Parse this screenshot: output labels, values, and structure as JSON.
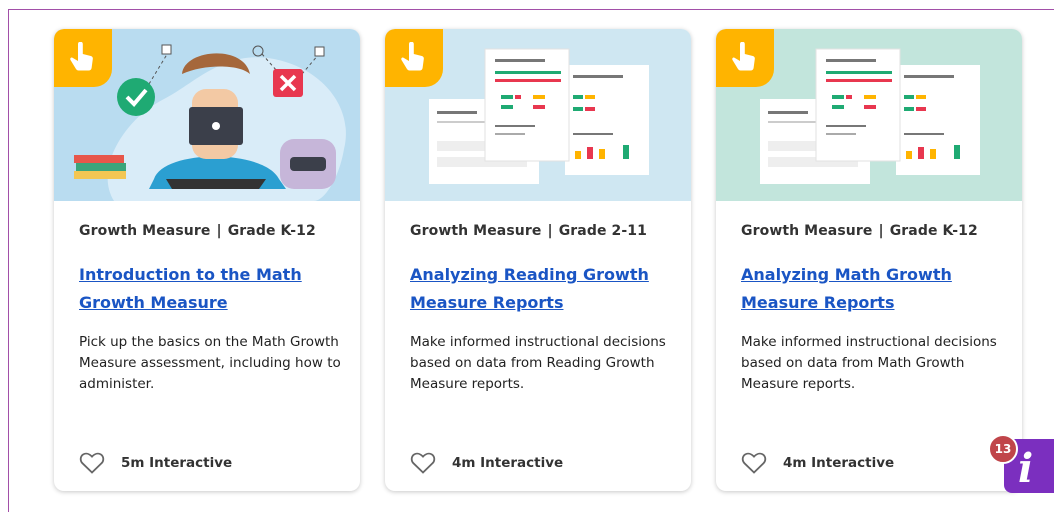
{
  "cards": [
    {
      "category": "Growth Measure",
      "grade": "Grade K-12",
      "title": "Introduction to the Math Growth Measure",
      "description": "Pick up the basics on the Math Growth Measure assessment, including how to administer.",
      "duration": "5m Interactive",
      "hero_bg": "#b9dcf0"
    },
    {
      "category": "Growth Measure",
      "grade": "Grade 2-11",
      "title": "Analyzing Reading Growth Measure Reports",
      "description": "Make informed instructional decisions based on data from Reading Growth Measure reports.",
      "duration": "4m Interactive",
      "hero_bg": "#cfe7f2"
    },
    {
      "category": "Growth Measure",
      "grade": "Grade K-12",
      "title": "Analyzing Math Growth Measure Reports",
      "description": "Make informed instructional decisions based on data from Math Growth Measure reports.",
      "duration": "4m Interactive",
      "hero_bg": "#c2e5dc"
    }
  ],
  "info_button": {
    "count": "13"
  },
  "colors": {
    "link": "#1a55c4",
    "badge": "#ffb400",
    "frame": "#a24fa8",
    "info": "#7b2fbf",
    "count_badge": "#c0454a"
  },
  "icons": {
    "badge": "pointer-hand-icon",
    "favorite": "heart-icon",
    "info": "info-icon"
  }
}
